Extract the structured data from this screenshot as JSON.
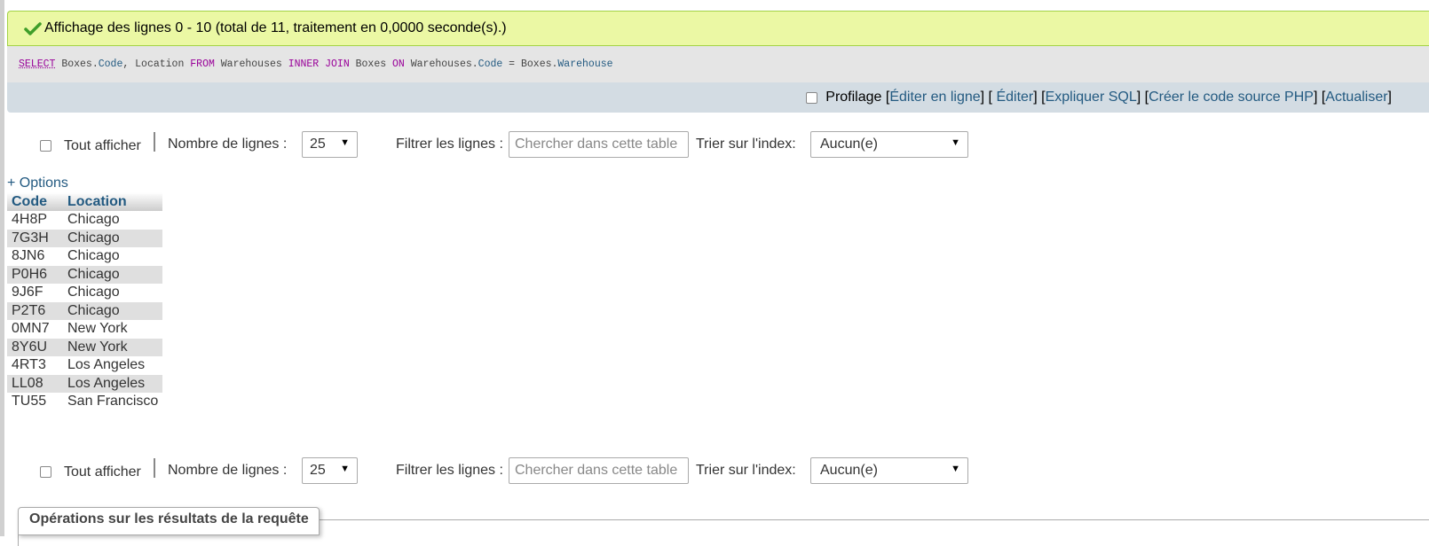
{
  "message": {
    "text": "Affichage des lignes 0 - 10 (total de 11, traitement en 0,0000 seconde(s).)",
    "icon": "check-icon"
  },
  "sql": {
    "select": "SELECT",
    "t1": " Boxes.",
    "code": "Code",
    "t2": ", Location ",
    "from": "FROM",
    "t3": " Warehouses ",
    "inner_join": "INNER JOIN",
    "t4": " Boxes ",
    "on": "ON",
    "t5": " Warehouses.",
    "code2": "Code",
    "t6": " = Boxes.",
    "warehouse": "Warehouse"
  },
  "tools": {
    "profilage": "Profilage",
    "edit_inline": "Éditer en ligne",
    "edit": "Éditer",
    "explain": "Expliquer SQL",
    "php": "Créer le code source PHP",
    "refresh": "Actualiser",
    "b_open": "[",
    "b_close": "]",
    "b_close_open": "] [",
    "b_sp_close_open": " ] [ ",
    "b_sp_close": " ]",
    "b_close_sp_open": "] [ "
  },
  "nav": {
    "show_all": "Tout afficher",
    "rows_label": "Nombre de lignes :",
    "rows_value": "25",
    "filter_label": "Filtrer les lignes :",
    "filter_placeholder": "Chercher dans cette table",
    "sort_label": "Trier sur l'index:",
    "sort_value": "Aucun(e)",
    "arrow": "▼"
  },
  "options_link": "+ Options",
  "table": {
    "headers": [
      "Code",
      "Location"
    ],
    "rows": [
      [
        "4H8P",
        "Chicago"
      ],
      [
        "7G3H",
        "Chicago"
      ],
      [
        "8JN6",
        "Chicago"
      ],
      [
        "P0H6",
        "Chicago"
      ],
      [
        "9J6F",
        "Chicago"
      ],
      [
        "P2T6",
        "Chicago"
      ],
      [
        "0MN7",
        "New York"
      ],
      [
        "8Y6U",
        "New York"
      ],
      [
        "4RT3",
        "Los Angeles"
      ],
      [
        "LL08",
        "Los Angeles"
      ],
      [
        "TU55",
        "San Francisco"
      ]
    ]
  },
  "operations": {
    "title": "Opérations sur les résultats de la requête"
  },
  "colors": {
    "success_bg": "#ebf8a4",
    "link": "#235a81",
    "sql_keyword": "#990099"
  }
}
